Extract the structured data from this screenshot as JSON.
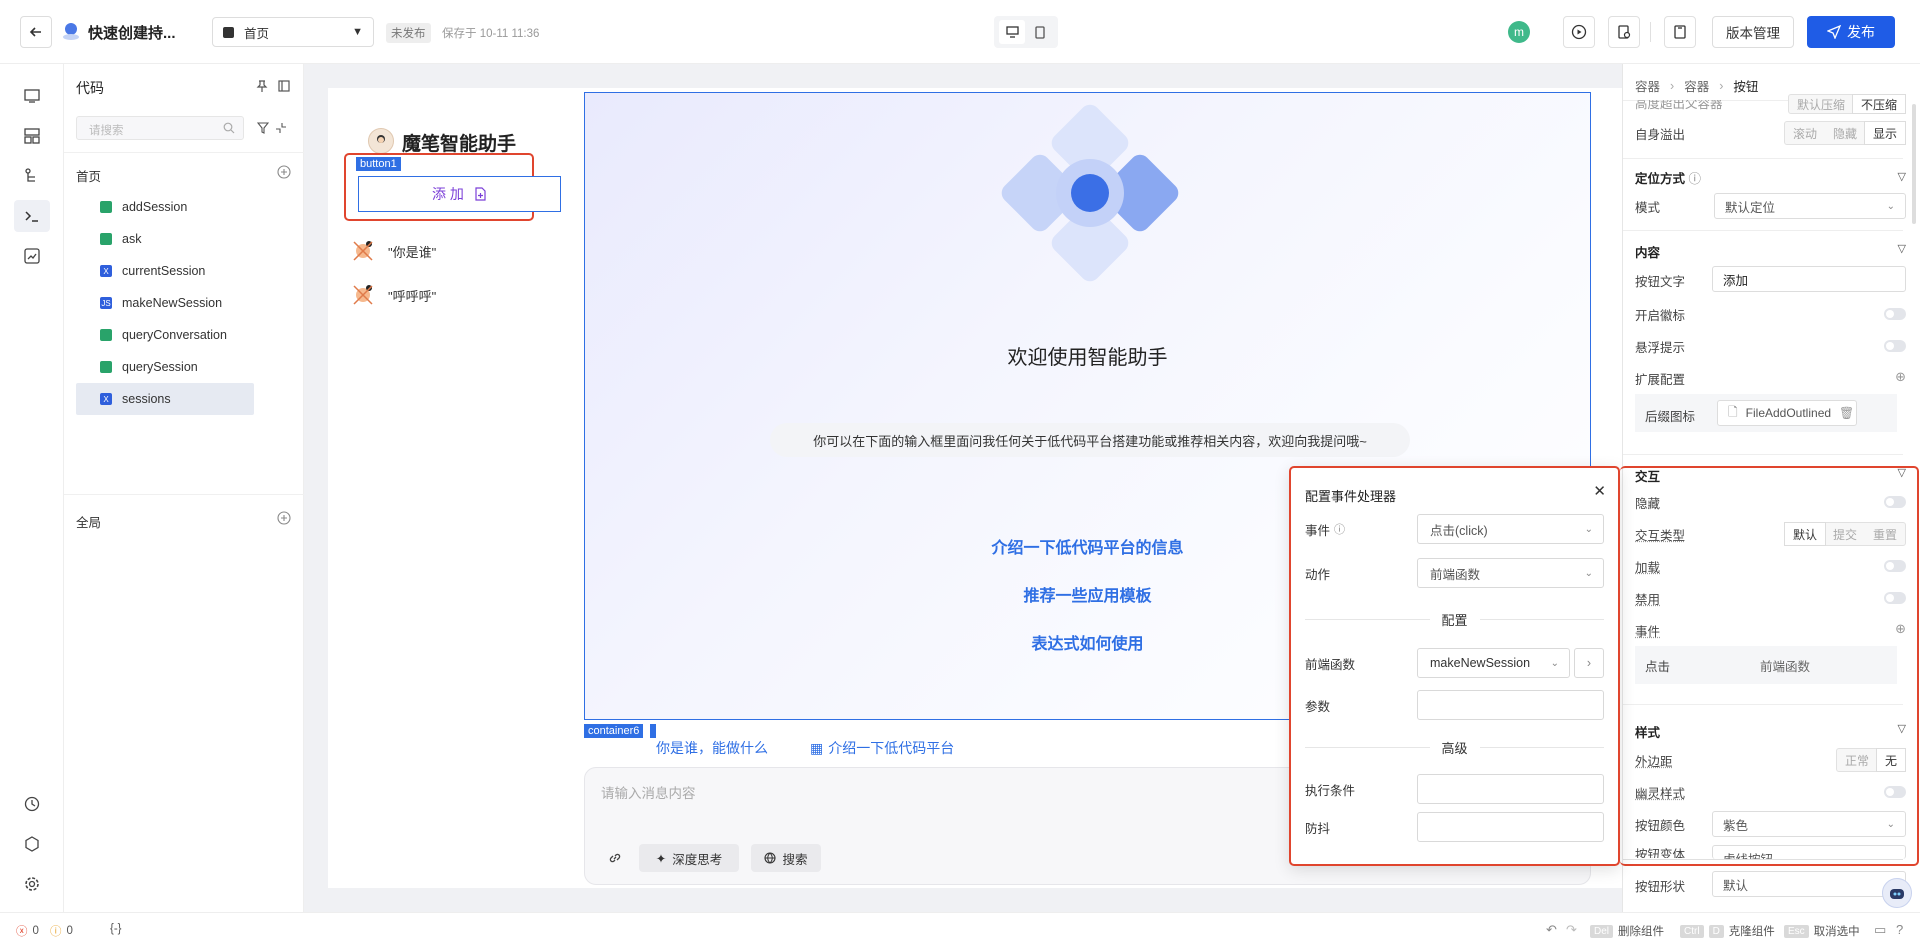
{
  "header": {
    "app_title": "快速创建持...",
    "page_select": "首页",
    "status_badge": "未发布",
    "save_time": "保存于 10-11 11:36",
    "avatar_letter": "m",
    "version_btn": "版本管理",
    "publish_btn": "发布"
  },
  "code_panel": {
    "title": "代码",
    "search_placeholder": "请搜索",
    "group_home": "首页",
    "items": [
      {
        "label": "addSession",
        "icon": "function-icon"
      },
      {
        "label": "ask",
        "icon": "function-icon"
      },
      {
        "label": "currentSession",
        "icon": "variable-icon"
      },
      {
        "label": "makeNewSession",
        "icon": "js-icon"
      },
      {
        "label": "queryConversation",
        "icon": "function-icon"
      },
      {
        "label": "querySession",
        "icon": "function-icon"
      },
      {
        "label": "sessions",
        "icon": "variable-icon"
      }
    ],
    "group_global": "全局"
  },
  "canvas": {
    "assistant_title": "魔笔智能助手",
    "button1_tag": "button1",
    "add_button": "添 加",
    "sessions": [
      "\"你是谁\"",
      "\"呼呼呼\""
    ],
    "welcome_title": "欢迎使用智能助手",
    "welcome_desc": "你可以在下面的输入框里面问我任何关于低代码平台搭建功能或推荐相关内容，欢迎向我提问哦~",
    "suggestions": [
      "介绍一下低代码平台的信息",
      "推荐一些应用模板",
      "表达式如何使用"
    ],
    "container_tag": "container6",
    "quick_chip_1": "你是谁，能做什么",
    "quick_chip_2": "介绍一下低代码平台",
    "input_placeholder": "请输入消息内容",
    "deep_think": "深度思考",
    "search": "搜索"
  },
  "dialog": {
    "title": "配置事件处理器",
    "event_label": "事件",
    "event_value": "点击(click)",
    "action_label": "动作",
    "action_value": "前端函数",
    "config_divider": "配置",
    "frontend_fn_label": "前端函数",
    "frontend_fn_value": "makeNewSession",
    "params_label": "参数",
    "advanced_divider": "高级",
    "condition_label": "执行条件",
    "debounce_label": "防抖"
  },
  "props": {
    "breadcrumb": [
      "容器",
      "容器",
      "按钮"
    ],
    "partial_top_label": "高度超出父容器",
    "partial_top_seg": [
      "默认压缩",
      "不压缩"
    ],
    "overflow_label": "自身溢出",
    "overflow_seg": [
      "滚动",
      "隐藏",
      "显示"
    ],
    "position_section": "定位方式",
    "mode_label": "模式",
    "mode_value": "默认定位",
    "content_section": "内容",
    "btn_text_label": "按钮文字",
    "btn_text_value": "添加",
    "badge_label": "开启徽标",
    "tooltip_label": "悬浮提示",
    "ext_label": "扩展配置",
    "suffix_icon_label": "后缀图标",
    "suffix_icon_value": "FileAddOutlined",
    "interact_section": "交互",
    "hide_label": "隐藏",
    "interact_type_label": "交互类型",
    "interact_type_seg": [
      "默认",
      "提交",
      "重置"
    ],
    "loading_label": "加载",
    "disable_label": "禁用",
    "event_label": "事件",
    "event_row_left": "点击",
    "event_row_right": "前端函数",
    "style_section": "样式",
    "margin_label": "外边距",
    "margin_seg": [
      "正常",
      "无"
    ],
    "ghost_label": "幽灵样式",
    "btn_color_label": "按钮颜色",
    "btn_color_value": "紫色",
    "btn_variant_label": "按钮变体",
    "btn_variant_value": "虚线按钮",
    "btn_shape_label": "按钮形状",
    "btn_shape_value": "默认"
  },
  "statusbar": {
    "errors": "0",
    "warnings": "0",
    "braces": "{-}",
    "del_key": "Del",
    "del_text": "删除组件",
    "ctrl_key": "Ctrl",
    "d_key": "D",
    "clone_text": "克隆组件",
    "esc_key": "Esc",
    "cancel_text": "取消选中"
  },
  "colors": {
    "primary": "#1f5ce6",
    "highlight_red": "#e0452e",
    "purple_btn": "#7b3fd8"
  }
}
